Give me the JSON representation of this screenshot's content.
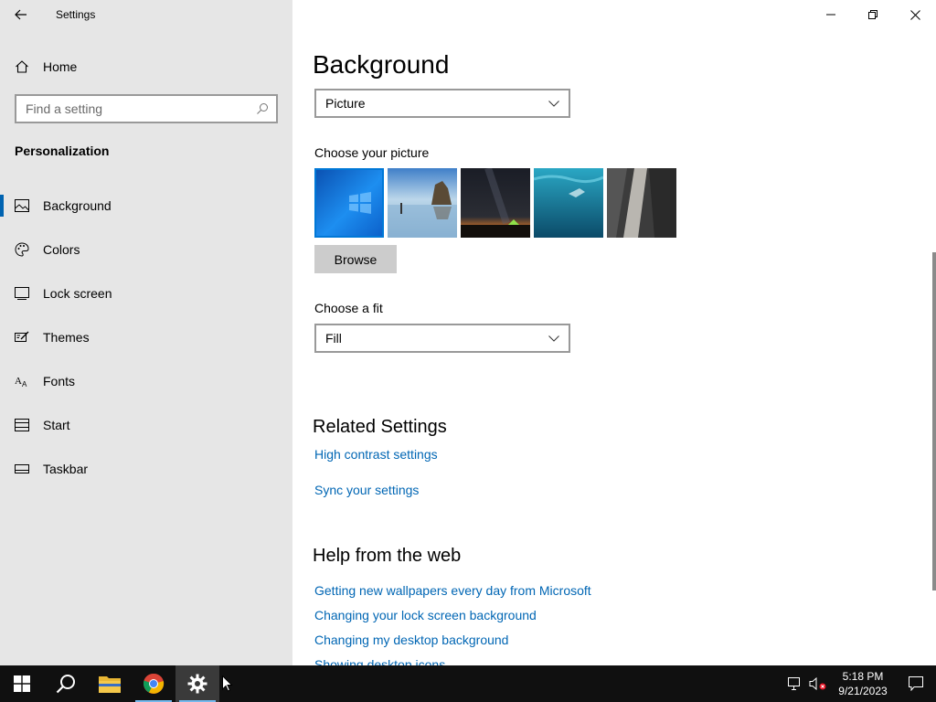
{
  "window": {
    "title": "Settings"
  },
  "sidebar": {
    "home_label": "Home",
    "search_placeholder": "Find a setting",
    "section_title": "Personalization",
    "items": [
      {
        "label": "Background",
        "icon": "picture-icon",
        "active": true
      },
      {
        "label": "Colors",
        "icon": "palette-icon"
      },
      {
        "label": "Lock screen",
        "icon": "lock-screen-icon"
      },
      {
        "label": "Themes",
        "icon": "themes-icon"
      },
      {
        "label": "Fonts",
        "icon": "fonts-icon"
      },
      {
        "label": "Start",
        "icon": "start-icon"
      },
      {
        "label": "Taskbar",
        "icon": "taskbar-icon"
      }
    ]
  },
  "main": {
    "heading": "Background",
    "background_type": "Picture",
    "choose_picture_label": "Choose your picture",
    "browse_label": "Browse",
    "choose_fit_label": "Choose a fit",
    "fit_value": "Fill",
    "related_heading": "Related Settings",
    "related_links": [
      "High contrast settings",
      "Sync your settings"
    ],
    "help_heading": "Help from the web",
    "help_links": [
      "Getting new wallpapers every day from Microsoft",
      "Changing your lock screen background",
      "Changing my desktop background",
      "Showing desktop icons"
    ]
  },
  "taskbar": {
    "time": "5:18 PM",
    "date": "9/21/2023"
  },
  "colors": {
    "accent": "#0078d7",
    "link": "#0066b4",
    "sidebar_bg": "#e6e6e6",
    "taskbar_bg": "#101010"
  }
}
